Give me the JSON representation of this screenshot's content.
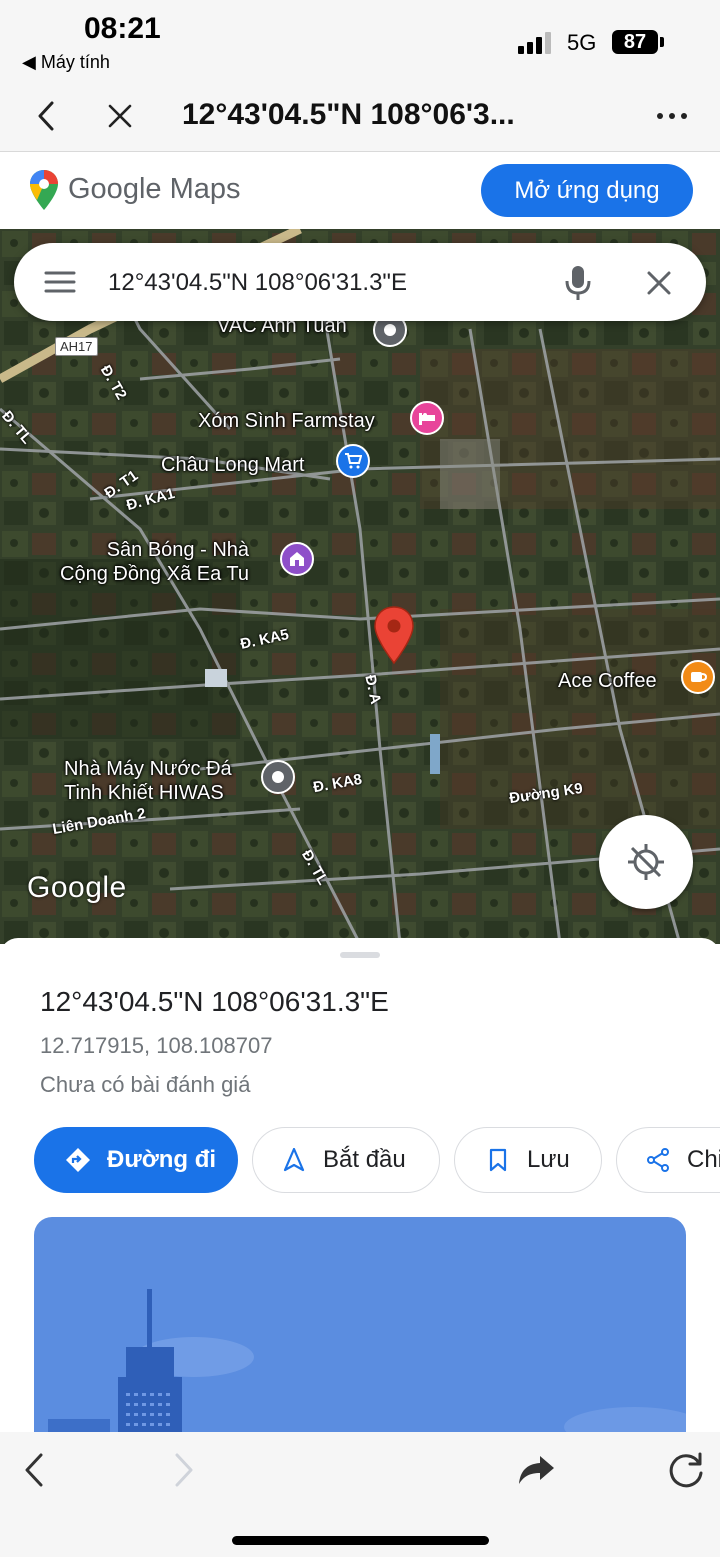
{
  "status_bar": {
    "time": "08:21",
    "back_app": "◀ Máy tính",
    "network": "5G",
    "battery": "87"
  },
  "browser": {
    "title": "12°43'04.5\"N 108°06'3...",
    "back_icon": "chevron-left-icon",
    "close_icon": "close-icon",
    "more_icon": "more-horizontal-icon"
  },
  "banner": {
    "logo_text": "Google Maps",
    "open_app_label": "Mở ứng dụng"
  },
  "search": {
    "value": "12°43'04.5\"N 108°06'31.3\"E"
  },
  "map": {
    "route_badge": "AH17",
    "pois": [
      {
        "label": "VAC Anh Tuấn",
        "icon": "place-pin-icon"
      },
      {
        "label": "Xóm Sình Farmstay",
        "icon": "hotel-icon",
        "color": "#e8449a"
      },
      {
        "label": "Châu Long Mart",
        "icon": "shopping-cart-icon",
        "color": "#1a73e8"
      },
      {
        "label": "Sân Bóng - Nhà\nCộng Đồng Xã Ea Tu",
        "icon": "community-icon",
        "color": "#8e4fc9"
      },
      {
        "label": "Ace Coffee",
        "icon": "coffee-icon",
        "color": "#f28b16"
      },
      {
        "label": "Nhà Máy Nước Đá\nTinh Khiết HIWAS",
        "icon": "place-pin-icon"
      }
    ],
    "roads": [
      "Đ. T2",
      "Đ. TL",
      "Đ. T1",
      "Đ. KA1",
      "Đ. KA5",
      "Đ. A",
      "Đ. KA8",
      "Đường K9",
      "Liên Doanh 2",
      "Đ. TL"
    ],
    "watermark": "Google"
  },
  "place": {
    "title": "12°43'04.5\"N 108°06'31.3\"E",
    "coordinates": "12.717915, 108.108707",
    "reviews": "Chưa có bài đánh giá",
    "actions": [
      {
        "label": "Đường đi",
        "icon": "directions-icon"
      },
      {
        "label": "Bắt đầu",
        "icon": "navigation-icon"
      },
      {
        "label": "Lưu",
        "icon": "bookmark-icon"
      },
      {
        "label": "Chi",
        "icon": "share-icon"
      }
    ]
  },
  "colors": {
    "accent": "#1a73e8",
    "pin": "#ea4335"
  }
}
